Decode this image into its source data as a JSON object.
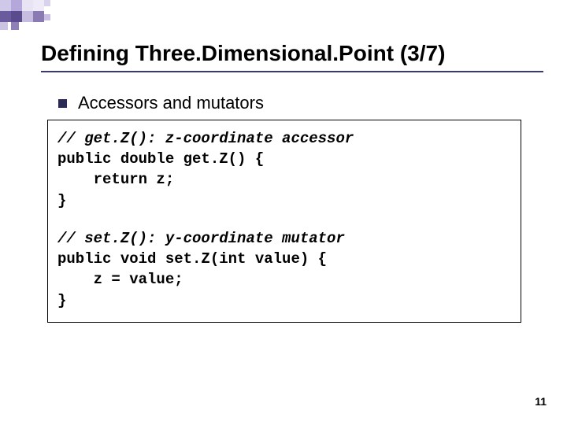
{
  "slide": {
    "title": "Defining Three.Dimensional.Point (3/7)",
    "bullet": "Accessors and mutators",
    "page_number": "11"
  },
  "code": {
    "comment1": "// get.Z(): z-coordinate accessor",
    "line1": "public double get.Z() {",
    "line2": "    return z;",
    "line3": "}",
    "comment2": "// set.Z(): y-coordinate mutator",
    "line4": "public void set.Z(int value) {",
    "line5": "    z = value;",
    "line6": "}"
  }
}
